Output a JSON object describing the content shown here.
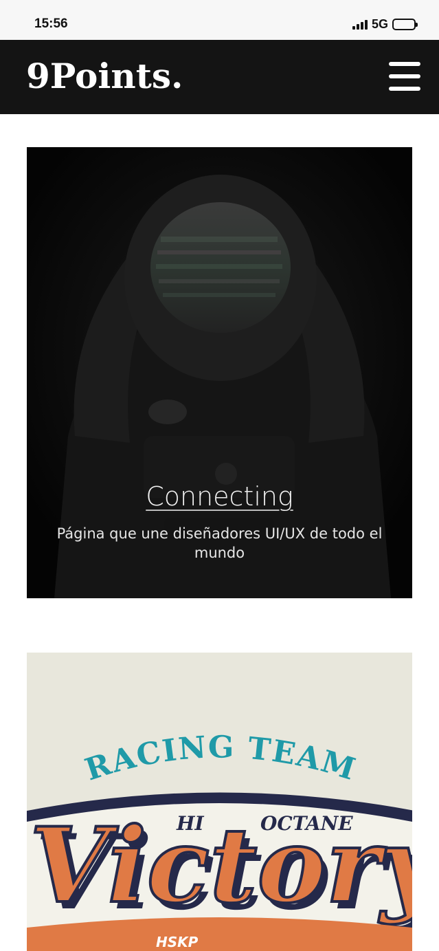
{
  "status_bar": {
    "time": "15:56",
    "network": "5G"
  },
  "header": {
    "logo": "9Points.",
    "menu_icon": "hamburger-menu-icon"
  },
  "cards": [
    {
      "image": "astronaut-photo",
      "title": "Connecting",
      "description": "Página que une diseñadores UI/UX de todo el mundo"
    },
    {
      "image": "racing-team-victory-illustration",
      "artwork_text": {
        "arc": "RACING TEAM",
        "left": "HI",
        "right": "OCTANE",
        "script": "Victory",
        "small": "HSKP"
      },
      "colors": {
        "teal": "#1f9aa8",
        "orange": "#e07a45",
        "navy": "#25294a",
        "cream": "#e8e7dc"
      }
    }
  ]
}
